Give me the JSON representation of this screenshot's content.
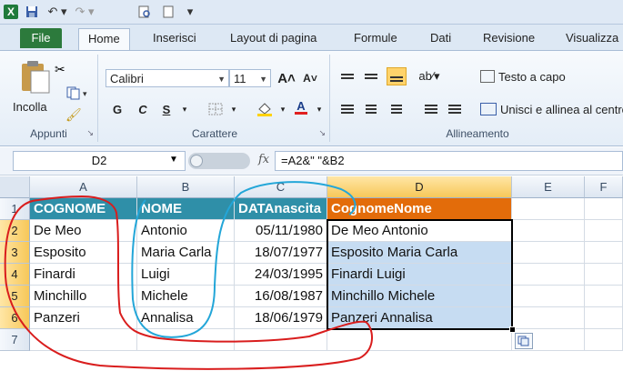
{
  "ribbon_tabs": [
    "File",
    "Home",
    "Inserisci",
    "Layout di pagina",
    "Formule",
    "Dati",
    "Revisione",
    "Visualizza"
  ],
  "clipboard": {
    "paste_label": "Incolla",
    "group_label": "Appunti"
  },
  "font": {
    "name": "Calibri",
    "size": "11",
    "group_label": "Carattere",
    "bold": "G",
    "italic": "C",
    "underline": "S"
  },
  "alignment": {
    "wrap_text": "Testo a capo",
    "merge_center": "Unisci e allinea al centro",
    "group_label": "Allineamento"
  },
  "formula_bar": {
    "name_box": "D2",
    "fx": "fx",
    "formula": "=A2&\" \"&B2"
  },
  "columns": [
    "A",
    "B",
    "C",
    "D",
    "E",
    "F"
  ],
  "rows": [
    "1",
    "2",
    "3",
    "4",
    "5",
    "6",
    "7"
  ],
  "table": {
    "headers": [
      "COGNOME",
      "NOME",
      "DATAnascita",
      "CognomeNome"
    ],
    "data": [
      [
        "De Meo",
        "Antonio",
        "05/11/1980",
        "De Meo Antonio"
      ],
      [
        "Esposito",
        "Maria Carla",
        "18/07/1977",
        "Esposito Maria Carla"
      ],
      [
        "Finardi",
        "Luigi",
        "24/03/1995",
        "Finardi Luigi"
      ],
      [
        "Minchillo",
        "Michele",
        "16/08/1987",
        "Minchillo Michele"
      ],
      [
        "Panzeri",
        "Annalisa",
        "18/06/1979",
        "Panzeri Annalisa"
      ]
    ]
  },
  "colors": {
    "header_teal": "#2f8fa8",
    "header_orange": "#e36c0a",
    "selection": "#c6dcf2",
    "annotation_red": "#d91d1d",
    "annotation_blue": "#23a6d8"
  }
}
